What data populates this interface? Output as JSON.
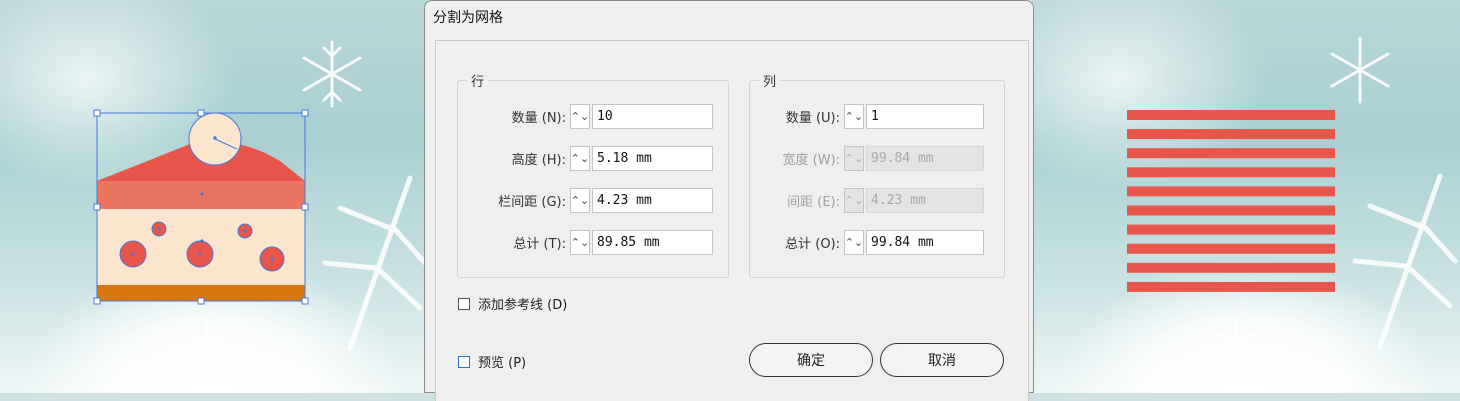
{
  "dialog": {
    "title": "分割为网格",
    "rows_group": {
      "title": "行",
      "count_label": "数量 (N):",
      "count_value": "10",
      "height_label": "高度 (H):",
      "height_value": "5.18 mm",
      "gutter_label": "栏间距 (G):",
      "gutter_value": "4.23 mm",
      "total_label": "总计 (T):",
      "total_value": "89.85 mm"
    },
    "cols_group": {
      "title": "列",
      "count_label": "数量 (U):",
      "count_value": "1",
      "width_label": "宽度 (W):",
      "width_value": "99.84 mm",
      "gutter_label": "间距 (E):",
      "gutter_value": "4.23 mm",
      "total_label": "总计 (O):",
      "total_value": "99.84 mm"
    },
    "add_guides_label": "添加参考线 (D)",
    "preview_label": "预览 (P)",
    "ok_label": "确定",
    "cancel_label": "取消"
  },
  "canvas": {
    "stripes": 10,
    "stripe_color": "#e8554a",
    "cake_colors": {
      "frosting": "#e8554a",
      "top_layer": "#ec7562",
      "cream": "#fbe5cf",
      "base": "#d9770f",
      "selection": "#4a78d8"
    }
  }
}
